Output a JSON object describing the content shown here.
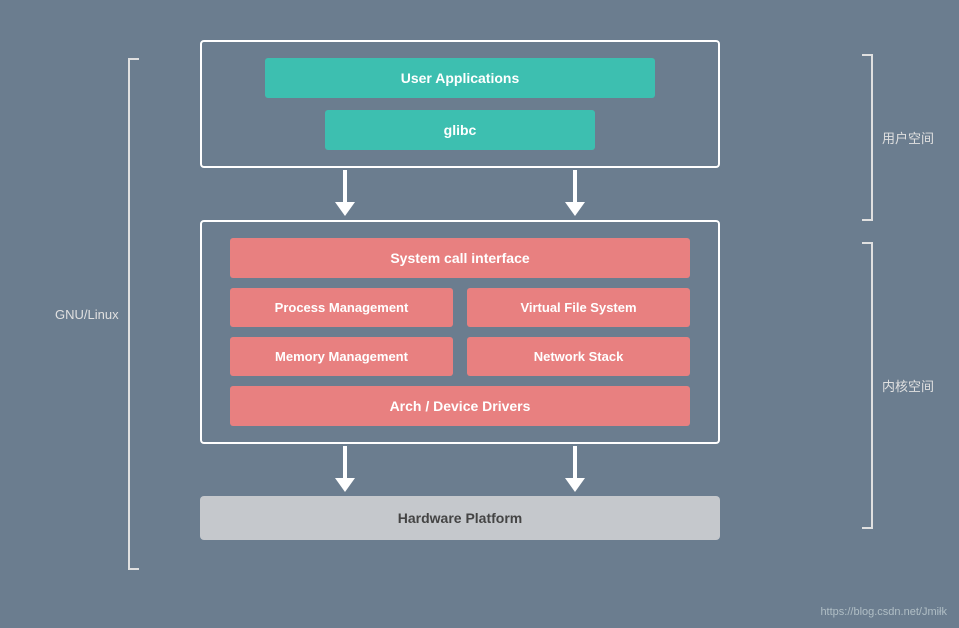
{
  "labels": {
    "gnu_linux": "GNU/Linux",
    "user_space": "用户空间",
    "kernel_space": "内核空间"
  },
  "user_space": {
    "user_apps": "User Applications",
    "glibc": "glibc"
  },
  "kernel_space": {
    "syscall": "System call interface",
    "process_mgmt": "Process Management",
    "vfs": "Virtual File System",
    "memory_mgmt": "Memory Management",
    "network_stack": "Network Stack",
    "arch_drivers": "Arch / Device Drivers"
  },
  "hardware": {
    "label": "Hardware Platform"
  },
  "watermark": "https://blog.csdn.net/Jmiłk"
}
